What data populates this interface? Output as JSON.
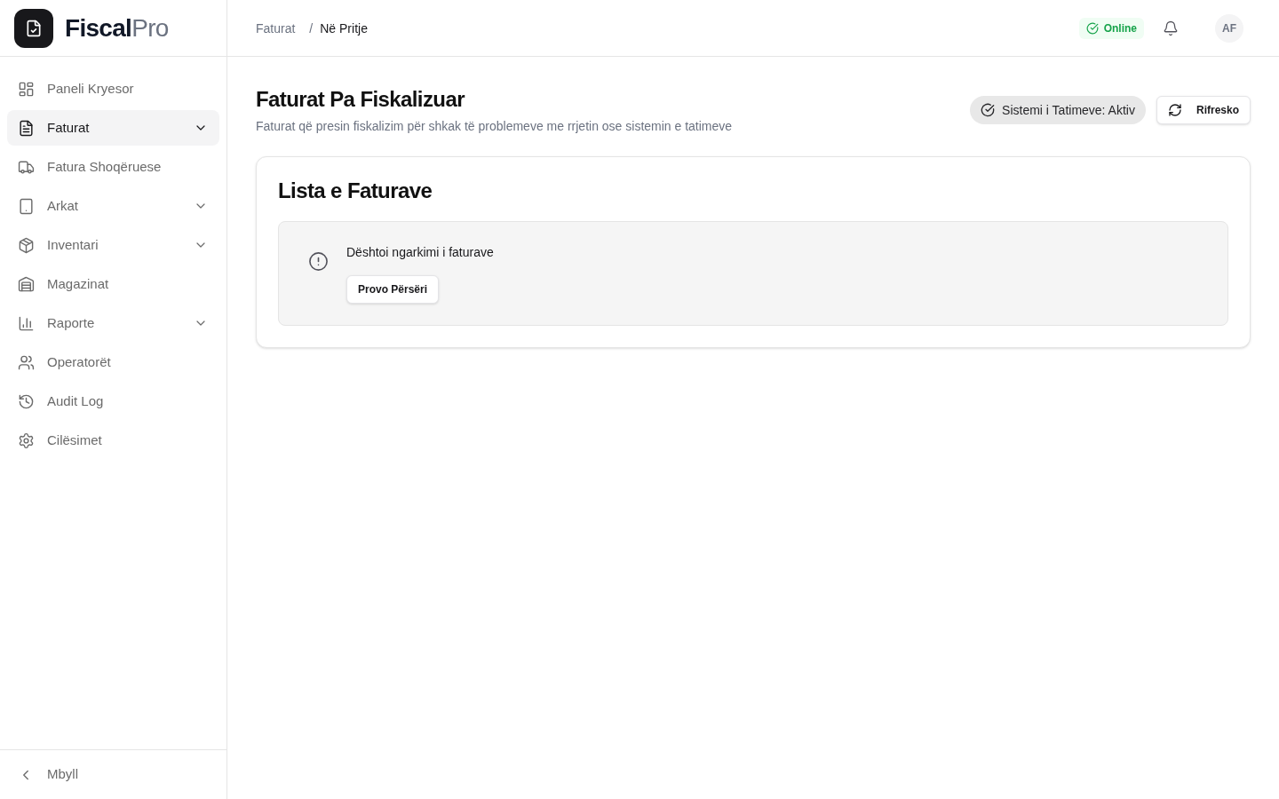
{
  "brand": {
    "name": "Fiscal",
    "suffix": "Pro"
  },
  "sidebar": {
    "items": [
      {
        "label": "Paneli Kryesor",
        "selected": false,
        "has_submenu": false
      },
      {
        "label": "Faturat",
        "selected": true,
        "has_submenu": true
      },
      {
        "label": "Fatura Shoqëruese",
        "selected": false,
        "has_submenu": false
      },
      {
        "label": "Arkat",
        "selected": false,
        "has_submenu": true
      },
      {
        "label": "Inventari",
        "selected": false,
        "has_submenu": true
      },
      {
        "label": "Magazinat",
        "selected": false,
        "has_submenu": false
      },
      {
        "label": "Raporte",
        "selected": false,
        "has_submenu": true
      },
      {
        "label": "Operatorët",
        "selected": false,
        "has_submenu": false
      },
      {
        "label": "Audit Log",
        "selected": false,
        "has_submenu": false
      },
      {
        "label": "Cilësimet",
        "selected": false,
        "has_submenu": false
      }
    ],
    "collapse": "Mbyll"
  },
  "header": {
    "breadcrumb": {
      "items": [
        "Faturat",
        "Në Pritje"
      ],
      "separator": "/"
    },
    "status": "Online",
    "avatar": "AF"
  },
  "page": {
    "title": "Faturat Pa Fiskalizuar",
    "subtitle": "Faturat që presin fiskalizim për shkak të problemeve me rrjetin ose sistemin e tatimeve",
    "tax_status": "Sistemi i Tatimeve: Aktiv",
    "refresh_button": "Rifresko"
  },
  "card": {
    "title": "Lista e Faturave",
    "error": {
      "message": "Dështoi ngarkimi i faturave",
      "retry_button": "Provo Përsëri"
    }
  }
}
